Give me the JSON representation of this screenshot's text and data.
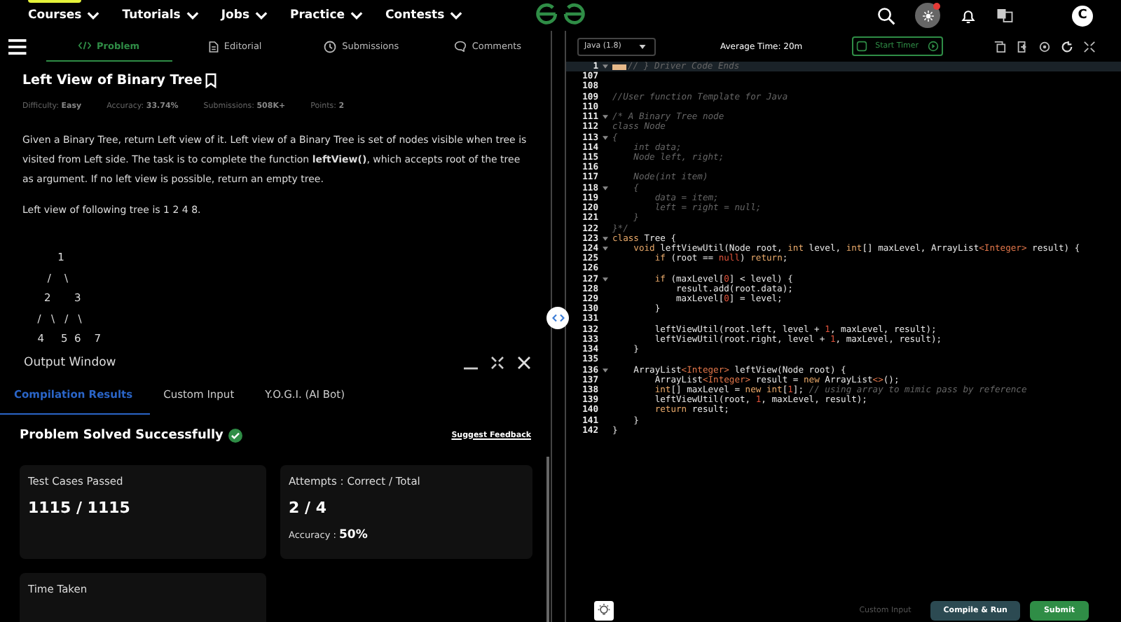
{
  "nav": {
    "items": [
      "Courses",
      "Tutorials",
      "Jobs",
      "Practice",
      "Contests"
    ],
    "avatar": "C",
    "notification": true
  },
  "tabs": [
    {
      "label": "Problem",
      "selected": true
    },
    {
      "label": "Editorial",
      "selected": false
    },
    {
      "label": "Submissions",
      "selected": false
    },
    {
      "label": "Comments",
      "selected": false
    }
  ],
  "problem": {
    "title": "Left View of Binary Tree",
    "meta": [
      {
        "label": "Difficulty:",
        "value": "Easy"
      },
      {
        "label": "Accuracy:",
        "value": "33.74%"
      },
      {
        "label": "Submissions:",
        "value": "508K+"
      },
      {
        "label": "Points:",
        "value": "2"
      }
    ],
    "description": "Given a Binary Tree, return Left view of it. Left view of a Binary Tree is set of nodes visible when tree is visited from Left side. The task is to complete the function **leftView()**, which accepts root of the tree as argument. If no left view is possible, return an empty tree.",
    "example": "Left view of following tree is 1 2 4 8.",
    "tree": [
      "        1",
      "     /    \\",
      "    2       3",
      "  /   \\   /   \\",
      "  4     5  6    7"
    ]
  },
  "output": {
    "title": "Output Window",
    "tabs": [
      {
        "label": "Compilation Results",
        "selected": true
      },
      {
        "label": "Custom Input",
        "selected": false
      },
      {
        "label": "Y.O.G.I. (AI Bot)",
        "selected": false
      }
    ],
    "status": "Problem Solved Successfully",
    "feedback": "Suggest Feedback",
    "cards": [
      {
        "label": "Test Cases Passed",
        "value": "1115 / 1115"
      },
      {
        "label": "Attempts : Correct / Total",
        "value": "2 / 4",
        "sub_label": "Accuracy :",
        "sub_value": "50%"
      },
      {
        "label": "Time Taken"
      }
    ]
  },
  "editor": {
    "language": "Java (1.8)",
    "average_time": "Average Time: 20m",
    "timer_button": "Start Timer",
    "lines": [
      {
        "num": "1",
        "fold": true,
        "widget": true,
        "current": true,
        "parts": [
          {
            "kind": "comment",
            "text": "// } Driver Code Ends"
          }
        ]
      },
      {
        "num": "107"
      },
      {
        "num": "108"
      },
      {
        "num": "109",
        "parts": [
          {
            "kind": "comment",
            "text": "//User function Template for Java"
          }
        ]
      },
      {
        "num": "110"
      },
      {
        "num": "111",
        "fold": true,
        "parts": [
          {
            "kind": "comment",
            "text": "/* A Binary Tree node"
          }
        ]
      },
      {
        "num": "112",
        "parts": [
          {
            "kind": "comment",
            "text": "class Node"
          }
        ]
      },
      {
        "num": "113",
        "fold": true,
        "parts": [
          {
            "kind": "comment",
            "text": "{"
          }
        ]
      },
      {
        "num": "114",
        "parts": [
          {
            "kind": "comment",
            "text": "    int data;"
          }
        ]
      },
      {
        "num": "115",
        "parts": [
          {
            "kind": "comment",
            "text": "    Node left, right;"
          }
        ]
      },
      {
        "num": "116"
      },
      {
        "num": "117",
        "parts": [
          {
            "kind": "comment",
            "text": "    Node(int item)"
          }
        ]
      },
      {
        "num": "118",
        "fold": true,
        "parts": [
          {
            "kind": "comment",
            "text": "    {"
          }
        ]
      },
      {
        "num": "119",
        "parts": [
          {
            "kind": "comment",
            "text": "        data = item;"
          }
        ]
      },
      {
        "num": "120",
        "parts": [
          {
            "kind": "comment",
            "text": "        left = right = null;"
          }
        ]
      },
      {
        "num": "121",
        "parts": [
          {
            "kind": "comment",
            "text": "    }"
          }
        ]
      },
      {
        "num": "122",
        "parts": [
          {
            "kind": "comment",
            "text": "}*/"
          }
        ]
      },
      {
        "num": "123",
        "fold": true,
        "parts": [
          {
            "kind": "keyword",
            "text": "class"
          },
          {
            "kind": "plain",
            "text": " Tree {"
          }
        ]
      },
      {
        "num": "124",
        "fold": true,
        "parts": [
          {
            "kind": "keyword",
            "text": "    void"
          },
          {
            "kind": "plain",
            "text": " leftViewUtil(Node root, "
          },
          {
            "kind": "keyword",
            "text": "int"
          },
          {
            "kind": "plain",
            "text": " level, "
          },
          {
            "kind": "keyword",
            "text": "int"
          },
          {
            "kind": "plain",
            "text": "[] maxLevel, ArrayList"
          },
          {
            "kind": "type",
            "text": "<Integer>"
          },
          {
            "kind": "plain",
            "text": " result) {"
          }
        ]
      },
      {
        "num": "125",
        "parts": [
          {
            "kind": "keyword",
            "text": "        if"
          },
          {
            "kind": "plain",
            "text": " (root == "
          },
          {
            "kind": "literal",
            "text": "null"
          },
          {
            "kind": "plain",
            "text": ") "
          },
          {
            "kind": "keyword",
            "text": "return"
          },
          {
            "kind": "plain",
            "text": ";"
          }
        ]
      },
      {
        "num": "126"
      },
      {
        "num": "127",
        "fold": true,
        "parts": [
          {
            "kind": "keyword",
            "text": "        if"
          },
          {
            "kind": "plain",
            "text": " (maxLevel["
          },
          {
            "kind": "literal",
            "text": "0"
          },
          {
            "kind": "plain",
            "text": "] < level) {"
          }
        ]
      },
      {
        "num": "128",
        "parts": [
          {
            "kind": "plain",
            "text": "            result.add(root.data);"
          }
        ]
      },
      {
        "num": "129",
        "parts": [
          {
            "kind": "plain",
            "text": "            maxLevel["
          },
          {
            "kind": "literal",
            "text": "0"
          },
          {
            "kind": "plain",
            "text": "] = level;"
          }
        ]
      },
      {
        "num": "130",
        "parts": [
          {
            "kind": "plain",
            "text": "        }"
          }
        ]
      },
      {
        "num": "131"
      },
      {
        "num": "132",
        "parts": [
          {
            "kind": "plain",
            "text": "        leftViewUtil(root.left, level + "
          },
          {
            "kind": "literal",
            "text": "1"
          },
          {
            "kind": "plain",
            "text": ", maxLevel, result);"
          }
        ]
      },
      {
        "num": "133",
        "parts": [
          {
            "kind": "plain",
            "text": "        leftViewUtil(root.right, level + "
          },
          {
            "kind": "literal",
            "text": "1"
          },
          {
            "kind": "plain",
            "text": ", maxLevel, result);"
          }
        ]
      },
      {
        "num": "134",
        "parts": [
          {
            "kind": "plain",
            "text": "    }"
          }
        ]
      },
      {
        "num": "135"
      },
      {
        "num": "136",
        "fold": true,
        "parts": [
          {
            "kind": "plain",
            "text": "    ArrayList"
          },
          {
            "kind": "type",
            "text": "<Integer>"
          },
          {
            "kind": "plain",
            "text": " leftView(Node root) {"
          }
        ]
      },
      {
        "num": "137",
        "parts": [
          {
            "kind": "plain",
            "text": "        ArrayList"
          },
          {
            "kind": "type",
            "text": "<Integer>"
          },
          {
            "kind": "plain",
            "text": " result = "
          },
          {
            "kind": "keyword",
            "text": "new"
          },
          {
            "kind": "plain",
            "text": " ArrayList"
          },
          {
            "kind": "type",
            "text": "<>"
          },
          {
            "kind": "plain",
            "text": "();"
          }
        ]
      },
      {
        "num": "138",
        "parts": [
          {
            "kind": "keyword",
            "text": "        int"
          },
          {
            "kind": "plain",
            "text": "[] maxLevel = "
          },
          {
            "kind": "keyword",
            "text": "new"
          },
          {
            "kind": "keyword",
            "text": " int"
          },
          {
            "kind": "plain",
            "text": "["
          },
          {
            "kind": "literal",
            "text": "1"
          },
          {
            "kind": "plain",
            "text": "]; "
          },
          {
            "kind": "comment",
            "text": "// using array to mimic pass by reference"
          }
        ]
      },
      {
        "num": "139",
        "parts": [
          {
            "kind": "plain",
            "text": "        leftViewUtil(root, "
          },
          {
            "kind": "literal",
            "text": "1"
          },
          {
            "kind": "plain",
            "text": ", maxLevel, result);"
          }
        ]
      },
      {
        "num": "140",
        "parts": [
          {
            "kind": "keyword",
            "text": "        return"
          },
          {
            "kind": "plain",
            "text": " result;"
          }
        ]
      },
      {
        "num": "141",
        "parts": [
          {
            "kind": "plain",
            "text": "    }"
          }
        ]
      },
      {
        "num": "142",
        "parts": [
          {
            "kind": "plain",
            "text": "}"
          }
        ]
      }
    ],
    "footer": {
      "custom_input": "Custom Input",
      "compile_button": "Compile & Run",
      "submit_button": "Submit"
    }
  }
}
